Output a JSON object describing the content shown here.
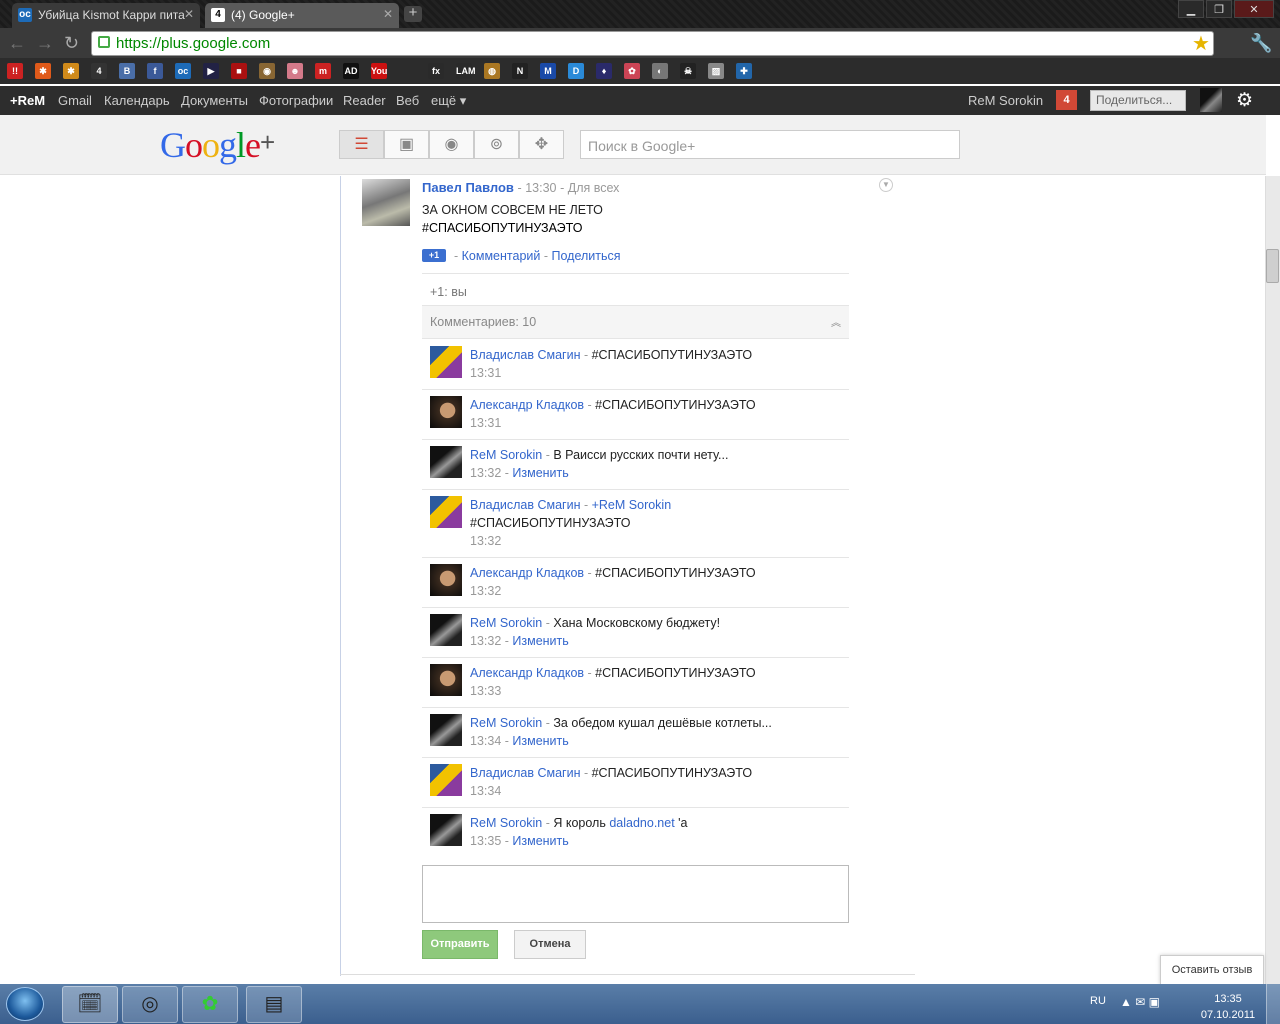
{
  "browser": {
    "tabs": [
      {
        "label": "Убийца Kismot Карри пита",
        "icon": "oc-favicon"
      },
      {
        "label": "(4) Google+",
        "icon": "google-plus-favicon",
        "badge": "4"
      }
    ],
    "url": "https://plus.google.com",
    "bookmarks": [
      {
        "text": "!!",
        "color": "#cc2222"
      },
      {
        "text": "✱",
        "color": "#e05a1a"
      },
      {
        "text": "✱",
        "color": "#d08a1a"
      },
      {
        "text": "4",
        "color": "#333333"
      },
      {
        "text": "В",
        "color": "#4a6ea8"
      },
      {
        "text": "f",
        "color": "#3b5998"
      },
      {
        "text": "oc",
        "color": "#1d6bb8"
      },
      {
        "text": "▶",
        "color": "#222244"
      },
      {
        "text": "■",
        "color": "#aa1111"
      },
      {
        "text": "◉",
        "color": "#886633"
      },
      {
        "text": "☻",
        "color": "#d47a8a"
      },
      {
        "text": "m",
        "color": "#cc2222"
      },
      {
        "text": "AD",
        "color": "#111111"
      },
      {
        "text": "You",
        "color": "#cc1111"
      },
      {
        "text": "fx",
        "color": "#2a2a2a"
      },
      {
        "text": "LAM",
        "color": "#2a2a2a"
      },
      {
        "text": "◍",
        "color": "#aa7722"
      },
      {
        "text": "N",
        "color": "#222222"
      },
      {
        "text": "M",
        "color": "#1a4aa8"
      },
      {
        "text": "D",
        "color": "#2a8ad8"
      },
      {
        "text": "♦",
        "color": "#2a2a6a"
      },
      {
        "text": "✿",
        "color": "#cc4455"
      },
      {
        "text": "◐",
        "color": "#777777"
      },
      {
        "text": "☠",
        "color": "#222222"
      },
      {
        "text": "▨",
        "color": "#888888"
      },
      {
        "text": "✚",
        "color": "#2266aa"
      }
    ]
  },
  "gbar": {
    "plus_name": "+ReM",
    "links": [
      "Gmail",
      "Календарь",
      "Документы",
      "Фотографии",
      "Reader",
      "Веб",
      "ещё ▾"
    ],
    "user_name": "ReM Sorokin",
    "notifications": "4",
    "share_button": "Поделиться..."
  },
  "header": {
    "logo_text": "Google",
    "logo_plus": "+",
    "search_placeholder": "Поиск в Google+",
    "nav_icons": [
      "home-icon",
      "photos-icon",
      "profile-icon",
      "circles-icon",
      "games-icon"
    ]
  },
  "post": {
    "author": "Павел Павлов",
    "time": "13:30",
    "visibility": "Для всех",
    "text_line1": "ЗА ОКНОМ СОВСЕМ НЕ ЛЕТО",
    "text_line2": "#СПАСИБОПУТИНУЗАЭТО",
    "plus1_label": "+1",
    "comment_link": "Комментарий",
    "share_link": "Поделиться",
    "plus_ones": "+1: вы",
    "comment_count": "Комментариев: 10"
  },
  "comments": [
    {
      "author": "Владислав Смагин",
      "text": "#СПАСИБОПУТИНУЗАЭТО",
      "time": "13:31",
      "edit": ""
    },
    {
      "author": "Александр Кладков",
      "text": "#СПАСИБОПУТИНУЗАЭТО",
      "time": "13:31",
      "edit": ""
    },
    {
      "author": "ReM Sorokin",
      "text": "В Раисси русских почти нету...",
      "time": "13:32",
      "edit": "Изменить"
    },
    {
      "author": "Владислав Смагин",
      "mention": "+ReM Sorokin",
      "text": "#СПАСИБОПУТИНУЗАЭТО",
      "time": "13:32",
      "edit": ""
    },
    {
      "author": "Александр Кладков",
      "text": "#СПАСИБОПУТИНУЗАЭТО",
      "time": "13:32",
      "edit": ""
    },
    {
      "author": "ReM Sorokin",
      "text": "Хана Московскому бюджету!",
      "time": "13:32",
      "edit": "Изменить"
    },
    {
      "author": "Александр Кладков",
      "text": "#СПАСИБОПУТИНУЗАЭТО",
      "time": "13:33",
      "edit": ""
    },
    {
      "author": "ReM Sorokin",
      "text": "За обедом кушал дешёвые котлеты...",
      "time": "13:34",
      "edit": "Изменить"
    },
    {
      "author": "Владислав Смагин",
      "text": "#СПАСИБОПУТИНУЗАЭТО",
      "time": "13:34",
      "edit": ""
    },
    {
      "author": "ReM Sorokin",
      "text_before": "Я король",
      "link": "daladno.net",
      "text_after": "'а",
      "time": "13:35",
      "edit": "Изменить"
    }
  ],
  "form": {
    "send": "Отправить",
    "cancel": "Отмена"
  },
  "feedback": "Оставить отзыв",
  "taskbar": {
    "lang": "RU",
    "time": "13:35",
    "date": "07.10.2011"
  }
}
